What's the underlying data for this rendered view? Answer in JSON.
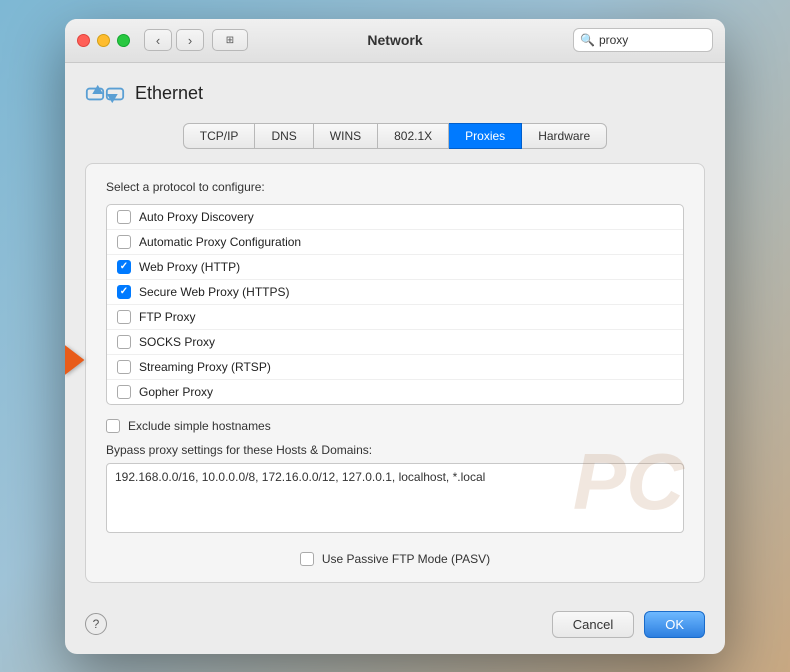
{
  "window": {
    "title": "Network"
  },
  "titlebar": {
    "back_icon": "‹",
    "forward_icon": "›",
    "grid_icon": "⊞",
    "search_placeholder": "proxy",
    "search_clear_icon": "×"
  },
  "ethernet": {
    "title": "Ethernet"
  },
  "tabs": [
    {
      "label": "TCP/IP",
      "active": false
    },
    {
      "label": "DNS",
      "active": false
    },
    {
      "label": "WINS",
      "active": false
    },
    {
      "label": "802.1X",
      "active": false
    },
    {
      "label": "Proxies",
      "active": true
    },
    {
      "label": "Hardware",
      "active": false
    }
  ],
  "proxies": {
    "section_label": "Select a protocol to configure:",
    "protocols": [
      {
        "label": "Auto Proxy Discovery",
        "checked": false
      },
      {
        "label": "Automatic Proxy Configuration",
        "checked": false
      },
      {
        "label": "Web Proxy (HTTP)",
        "checked": true
      },
      {
        "label": "Secure Web Proxy (HTTPS)",
        "checked": true
      },
      {
        "label": "FTP Proxy",
        "checked": false
      },
      {
        "label": "SOCKS Proxy",
        "checked": false
      },
      {
        "label": "Streaming Proxy (RTSP)",
        "checked": false
      },
      {
        "label": "Gopher Proxy",
        "checked": false
      }
    ],
    "exclude_hostnames_label": "Exclude simple hostnames",
    "exclude_hostnames_checked": false,
    "bypass_label": "Bypass proxy settings for these Hosts & Domains:",
    "bypass_value": "192.168.0.0/16, 10.0.0.0/8, 172.16.0.0/12, 127.0.0.1, localhost, *.local",
    "pasv_label": "Use Passive FTP Mode (PASV)",
    "pasv_checked": false
  },
  "footer": {
    "help_label": "?",
    "cancel_label": "Cancel",
    "ok_label": "OK"
  }
}
